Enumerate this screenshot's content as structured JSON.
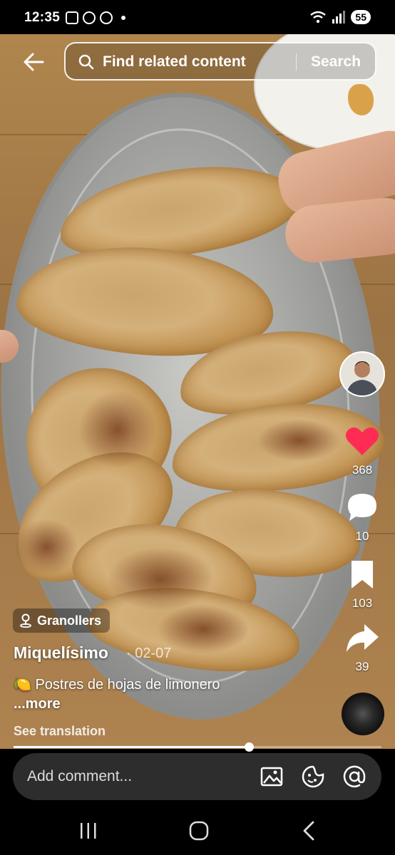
{
  "status_bar": {
    "time": "12:35",
    "battery": "55"
  },
  "search": {
    "placeholder": "Find related content",
    "button_label": "Search"
  },
  "rail": {
    "likes": "368",
    "comments": "10",
    "saves": "103",
    "shares": "39"
  },
  "post": {
    "location": "Granollers",
    "username": "Miquelísimo",
    "date": "· 02-07",
    "caption": "🍋 Postres de hojas de limonero",
    "more_label": "...more",
    "translate_label": "See translation",
    "progress": 0.64
  },
  "comment": {
    "placeholder": "Add comment..."
  },
  "colors": {
    "like": "#fe2c55",
    "comment_bg": "#2d2d2d"
  }
}
